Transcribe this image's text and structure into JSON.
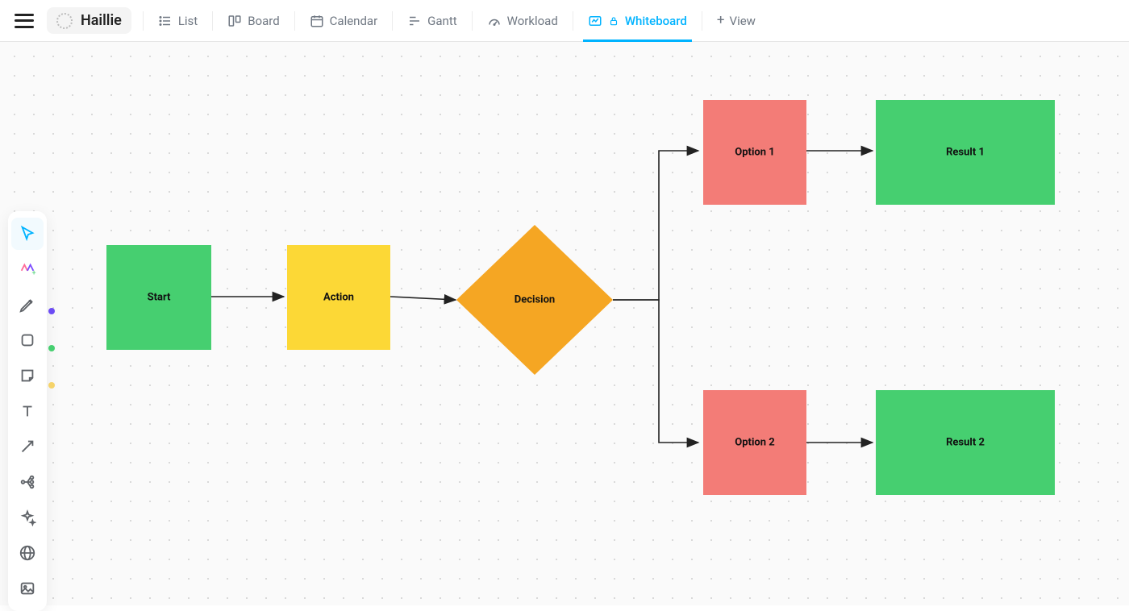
{
  "project_name": "Haillie",
  "views": {
    "list": "List",
    "board": "Board",
    "calendar": "Calendar",
    "gantt": "Gantt",
    "workload": "Workload",
    "whiteboard": "Whiteboard",
    "add_view": "View"
  },
  "tools": {
    "select": "select-tool",
    "ai": "ai-tool",
    "pen": "pen-tool",
    "shape": "shape-tool",
    "sticky": "sticky-note-tool",
    "text": "text-tool",
    "connector": "connector-tool",
    "mindmap": "mindmap-tool",
    "templates": "templates-tool",
    "embed": "embed-tool",
    "image": "image-tool"
  },
  "tool_colors": {
    "pen": "#6c4cf5",
    "shape": "#46cf70",
    "sticky": "#f5d36a"
  },
  "nodes": {
    "start": {
      "label": "Start",
      "color": "green"
    },
    "action": {
      "label": "Action",
      "color": "yellow"
    },
    "decision": {
      "label": "Decision",
      "color": "orange"
    },
    "option1": {
      "label": "Option 1",
      "color": "red"
    },
    "option2": {
      "label": "Option 2",
      "color": "red"
    },
    "result1": {
      "label": "Result 1",
      "color": "green"
    },
    "result2": {
      "label": "Result 2",
      "color": "green"
    }
  },
  "edges": [
    [
      "start",
      "action"
    ],
    [
      "action",
      "decision"
    ],
    [
      "decision",
      "option1"
    ],
    [
      "decision",
      "option2"
    ],
    [
      "option1",
      "result1"
    ],
    [
      "option2",
      "result2"
    ]
  ],
  "chart_data": {
    "type": "flowchart",
    "nodes": [
      {
        "id": "start",
        "label": "Start",
        "shape": "rect"
      },
      {
        "id": "action",
        "label": "Action",
        "shape": "rect"
      },
      {
        "id": "decision",
        "label": "Decision",
        "shape": "diamond"
      },
      {
        "id": "option1",
        "label": "Option 1",
        "shape": "rect"
      },
      {
        "id": "option2",
        "label": "Option 2",
        "shape": "rect"
      },
      {
        "id": "result1",
        "label": "Result 1",
        "shape": "rect"
      },
      {
        "id": "result2",
        "label": "Result 2",
        "shape": "rect"
      }
    ],
    "edges": [
      {
        "from": "start",
        "to": "action"
      },
      {
        "from": "action",
        "to": "decision"
      },
      {
        "from": "decision",
        "to": "option1"
      },
      {
        "from": "decision",
        "to": "option2"
      },
      {
        "from": "option1",
        "to": "result1"
      },
      {
        "from": "option2",
        "to": "result2"
      }
    ]
  }
}
